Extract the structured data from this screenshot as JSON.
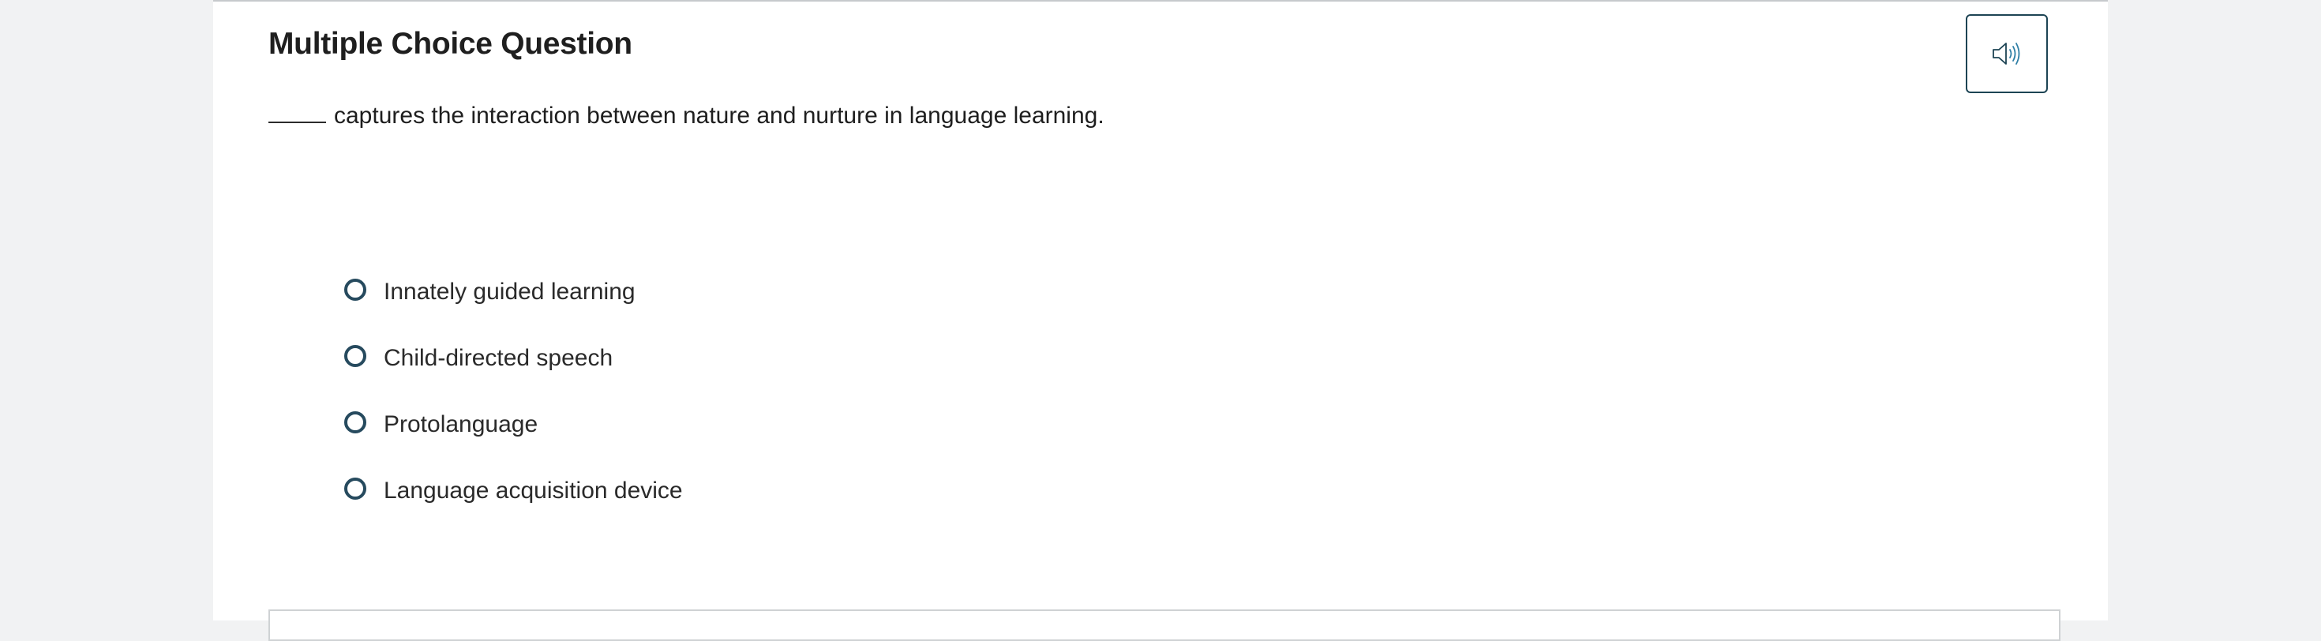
{
  "question": {
    "title": "Multiple Choice Question",
    "prompt_suffix": "captures the interaction between nature and nurture in language learning."
  },
  "audio_button": {
    "icon": "speaker-icon",
    "color": "#1d4454"
  },
  "options": [
    {
      "label": "Innately guided learning",
      "selected": false
    },
    {
      "label": "Child-directed speech",
      "selected": false
    },
    {
      "label": "Protolanguage",
      "selected": false
    },
    {
      "label": "Language acquisition device",
      "selected": false
    }
  ]
}
